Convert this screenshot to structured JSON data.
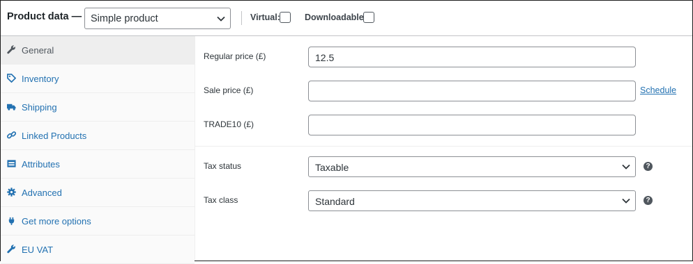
{
  "header": {
    "title": "Product data —",
    "product_type": "Simple product",
    "virtual_label": "Virtual:",
    "downloadable_label": "Downloadable:"
  },
  "sidebar": {
    "items": [
      {
        "label": "General",
        "icon": "wrench-icon",
        "active": true
      },
      {
        "label": "Inventory",
        "icon": "tag-icon",
        "active": false
      },
      {
        "label": "Shipping",
        "icon": "truck-icon",
        "active": false
      },
      {
        "label": "Linked Products",
        "icon": "link-icon",
        "active": false
      },
      {
        "label": "Attributes",
        "icon": "table-icon",
        "active": false
      },
      {
        "label": "Advanced",
        "icon": "gear-icon",
        "active": false
      },
      {
        "label": "Get more options",
        "icon": "plug-icon",
        "active": false
      },
      {
        "label": "EU VAT",
        "icon": "wrench-icon",
        "active": false
      }
    ]
  },
  "general": {
    "regular_price_label": "Regular price (£)",
    "regular_price_value": "12.5",
    "sale_price_label": "Sale price (£)",
    "sale_price_value": "",
    "schedule_link": "Schedule",
    "trade10_label": "TRADE10 (£)",
    "trade10_value": "",
    "tax_status_label": "Tax status",
    "tax_status_value": "Taxable",
    "tax_class_label": "Tax class",
    "tax_class_value": "Standard",
    "help_glyph": "?"
  },
  "colors": {
    "link": "#2271b1",
    "active_tab_bg": "#eeeeee",
    "sidebar_bg": "#fafafa"
  }
}
